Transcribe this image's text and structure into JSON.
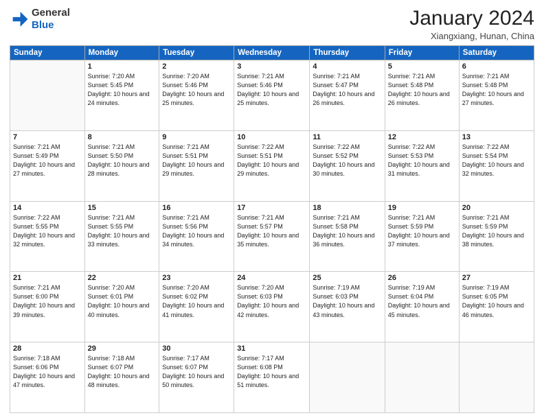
{
  "header": {
    "logo_line1": "General",
    "logo_line2": "Blue",
    "month": "January 2024",
    "location": "Xiangxiang, Hunan, China"
  },
  "weekdays": [
    "Sunday",
    "Monday",
    "Tuesday",
    "Wednesday",
    "Thursday",
    "Friday",
    "Saturday"
  ],
  "weeks": [
    [
      {
        "day": "",
        "empty": true
      },
      {
        "day": "1",
        "sunrise": "7:20 AM",
        "sunset": "5:45 PM",
        "daylight": "10 hours and 24 minutes."
      },
      {
        "day": "2",
        "sunrise": "7:20 AM",
        "sunset": "5:46 PM",
        "daylight": "10 hours and 25 minutes."
      },
      {
        "day": "3",
        "sunrise": "7:21 AM",
        "sunset": "5:46 PM",
        "daylight": "10 hours and 25 minutes."
      },
      {
        "day": "4",
        "sunrise": "7:21 AM",
        "sunset": "5:47 PM",
        "daylight": "10 hours and 26 minutes."
      },
      {
        "day": "5",
        "sunrise": "7:21 AM",
        "sunset": "5:48 PM",
        "daylight": "10 hours and 26 minutes."
      },
      {
        "day": "6",
        "sunrise": "7:21 AM",
        "sunset": "5:48 PM",
        "daylight": "10 hours and 27 minutes."
      }
    ],
    [
      {
        "day": "7",
        "sunrise": "7:21 AM",
        "sunset": "5:49 PM",
        "daylight": "10 hours and 27 minutes."
      },
      {
        "day": "8",
        "sunrise": "7:21 AM",
        "sunset": "5:50 PM",
        "daylight": "10 hours and 28 minutes."
      },
      {
        "day": "9",
        "sunrise": "7:21 AM",
        "sunset": "5:51 PM",
        "daylight": "10 hours and 29 minutes."
      },
      {
        "day": "10",
        "sunrise": "7:22 AM",
        "sunset": "5:51 PM",
        "daylight": "10 hours and 29 minutes."
      },
      {
        "day": "11",
        "sunrise": "7:22 AM",
        "sunset": "5:52 PM",
        "daylight": "10 hours and 30 minutes."
      },
      {
        "day": "12",
        "sunrise": "7:22 AM",
        "sunset": "5:53 PM",
        "daylight": "10 hours and 31 minutes."
      },
      {
        "day": "13",
        "sunrise": "7:22 AM",
        "sunset": "5:54 PM",
        "daylight": "10 hours and 32 minutes."
      }
    ],
    [
      {
        "day": "14",
        "sunrise": "7:22 AM",
        "sunset": "5:55 PM",
        "daylight": "10 hours and 32 minutes."
      },
      {
        "day": "15",
        "sunrise": "7:21 AM",
        "sunset": "5:55 PM",
        "daylight": "10 hours and 33 minutes."
      },
      {
        "day": "16",
        "sunrise": "7:21 AM",
        "sunset": "5:56 PM",
        "daylight": "10 hours and 34 minutes."
      },
      {
        "day": "17",
        "sunrise": "7:21 AM",
        "sunset": "5:57 PM",
        "daylight": "10 hours and 35 minutes."
      },
      {
        "day": "18",
        "sunrise": "7:21 AM",
        "sunset": "5:58 PM",
        "daylight": "10 hours and 36 minutes."
      },
      {
        "day": "19",
        "sunrise": "7:21 AM",
        "sunset": "5:59 PM",
        "daylight": "10 hours and 37 minutes."
      },
      {
        "day": "20",
        "sunrise": "7:21 AM",
        "sunset": "5:59 PM",
        "daylight": "10 hours and 38 minutes."
      }
    ],
    [
      {
        "day": "21",
        "sunrise": "7:21 AM",
        "sunset": "6:00 PM",
        "daylight": "10 hours and 39 minutes."
      },
      {
        "day": "22",
        "sunrise": "7:20 AM",
        "sunset": "6:01 PM",
        "daylight": "10 hours and 40 minutes."
      },
      {
        "day": "23",
        "sunrise": "7:20 AM",
        "sunset": "6:02 PM",
        "daylight": "10 hours and 41 minutes."
      },
      {
        "day": "24",
        "sunrise": "7:20 AM",
        "sunset": "6:03 PM",
        "daylight": "10 hours and 42 minutes."
      },
      {
        "day": "25",
        "sunrise": "7:19 AM",
        "sunset": "6:03 PM",
        "daylight": "10 hours and 43 minutes."
      },
      {
        "day": "26",
        "sunrise": "7:19 AM",
        "sunset": "6:04 PM",
        "daylight": "10 hours and 45 minutes."
      },
      {
        "day": "27",
        "sunrise": "7:19 AM",
        "sunset": "6:05 PM",
        "daylight": "10 hours and 46 minutes."
      }
    ],
    [
      {
        "day": "28",
        "sunrise": "7:18 AM",
        "sunset": "6:06 PM",
        "daylight": "10 hours and 47 minutes."
      },
      {
        "day": "29",
        "sunrise": "7:18 AM",
        "sunset": "6:07 PM",
        "daylight": "10 hours and 48 minutes."
      },
      {
        "day": "30",
        "sunrise": "7:17 AM",
        "sunset": "6:07 PM",
        "daylight": "10 hours and 50 minutes."
      },
      {
        "day": "31",
        "sunrise": "7:17 AM",
        "sunset": "6:08 PM",
        "daylight": "10 hours and 51 minutes."
      },
      {
        "day": "",
        "empty": true
      },
      {
        "day": "",
        "empty": true
      },
      {
        "day": "",
        "empty": true
      }
    ]
  ]
}
